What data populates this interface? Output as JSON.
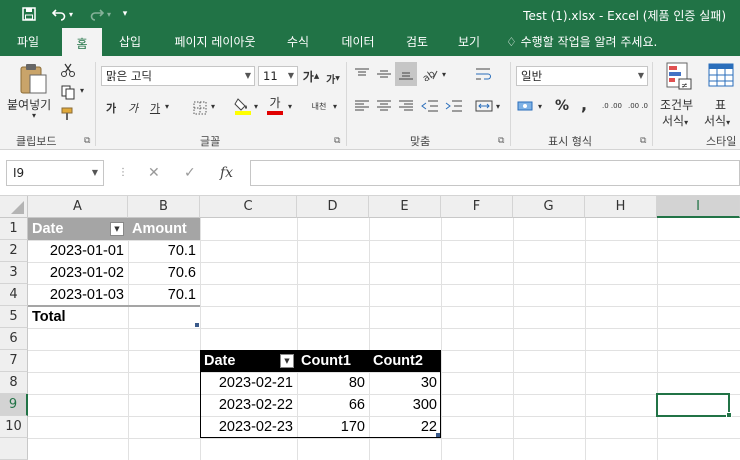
{
  "window": {
    "title": "Test (1).xlsx - Excel (제품 인증 실패)"
  },
  "qat": {
    "save_icon": "save-icon",
    "undo_icon": "undo-icon",
    "redo_icon": "redo-icon",
    "customize": "▾"
  },
  "tabs": [
    {
      "label": "파일"
    },
    {
      "label": "홈"
    },
    {
      "label": "삽입"
    },
    {
      "label": "페이지 레이아웃"
    },
    {
      "label": "수식"
    },
    {
      "label": "데이터"
    },
    {
      "label": "검토"
    },
    {
      "label": "보기"
    }
  ],
  "tell_me": "수행할 작업을 알려 주세요.",
  "ribbon": {
    "paste_label": "붙여넣기",
    "clipboard_group": "클립보드",
    "font_name": "맑은 고딕",
    "font_size": "11",
    "font_group": "글꼴",
    "align_group": "맞춤",
    "number_format": "일반",
    "number_group": "표시 형식",
    "cond_format_label_1": "조건부",
    "cond_format_label_2": "서식",
    "table_format_label_1": "표",
    "table_format_label_2": "서식",
    "style_group": "스타일",
    "bold": "가",
    "italic": "가",
    "underline": "가",
    "grow_font": "가",
    "shrink_font": "가",
    "font_color": "가",
    "phonetic": "내천",
    "percent": "%",
    "comma": ",",
    "inc_decimal": ".0 .00",
    "dec_decimal": ".00 .0"
  },
  "formula_bar": {
    "name_box": "I9",
    "cancel": "✕",
    "enter": "✓",
    "fx": "fx",
    "value": ""
  },
  "grid": {
    "columns": [
      "A",
      "B",
      "C",
      "D",
      "E",
      "F",
      "G",
      "H",
      "I"
    ],
    "rows": [
      "1",
      "2",
      "3",
      "4",
      "5",
      "6",
      "7",
      "8",
      "9",
      "10"
    ],
    "selected_cell": "I9"
  },
  "table1": {
    "headers": [
      "Date",
      "Amount"
    ],
    "rows": [
      [
        "2023-01-01",
        "70.1"
      ],
      [
        "2023-01-02",
        "70.6"
      ],
      [
        "2023-01-03",
        "70.1"
      ]
    ],
    "total_label": "Total"
  },
  "table2": {
    "headers": [
      "Date",
      "Count1",
      "Count2"
    ],
    "rows": [
      [
        "2023-02-21",
        "80",
        "30"
      ],
      [
        "2023-02-22",
        "66",
        "300"
      ],
      [
        "2023-02-23",
        "170",
        "22"
      ]
    ]
  },
  "colors": {
    "accent": "#217346",
    "table1_header": "#a5a5a5",
    "table2_header": "#000000"
  }
}
